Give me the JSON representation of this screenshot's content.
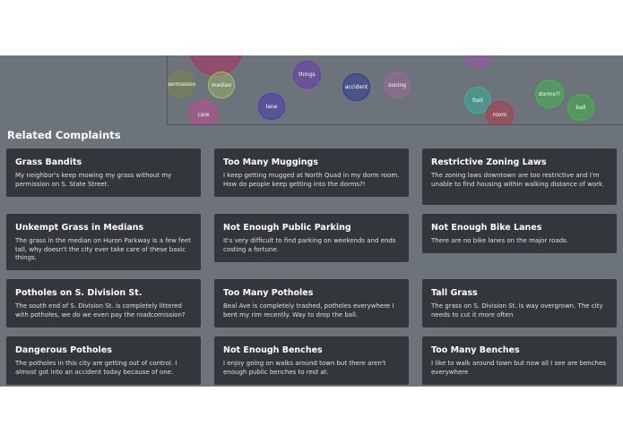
{
  "bubbles": [
    {
      "label": "",
      "color": "#b03060"
    },
    {
      "label": "",
      "color": "#a050b0"
    },
    {
      "label": "permission",
      "color": "#7a8a3a"
    },
    {
      "label": "median",
      "color": "#a8c060"
    },
    {
      "label": "things",
      "color": "#6a3ab0"
    },
    {
      "label": "accident",
      "color": "#303a90"
    },
    {
      "label": "zoning",
      "color": "#a06a9a"
    },
    {
      "label": "lane",
      "color": "#4a3ab0"
    },
    {
      "label": "care",
      "color": "#c04a90"
    },
    {
      "label": "foot",
      "color": "#30b8a0"
    },
    {
      "label": "dorms?!",
      "color": "#3ac04a"
    },
    {
      "label": "room",
      "color": "#b03a4a"
    },
    {
      "label": "ball",
      "color": "#3ac040"
    }
  ],
  "section": {
    "title": "Related Complaints"
  },
  "complaints": [
    {
      "title": "Grass Bandits",
      "body": "My neighbor's keep mowing my grass without my permission on S. State Street."
    },
    {
      "title": "Too Many Muggings",
      "body": "I keep getting mugged at North Quad in my dorm room. How do people keep getting into the dorms?!"
    },
    {
      "title": "Restrictive Zoning Laws",
      "body": "The zoning laws downtown are too restrictive and I'm unable to find housing within walking distance of work."
    },
    {
      "title": "Unkempt Grass in Medians",
      "body": "The grass in the median on Huron Parkway is a few feet tall, why doesn't the city ever take care of these basic things."
    },
    {
      "title": "Not Enough Public Parking",
      "body": "It's very difficult to find parking on weekends and ends costing a fortune."
    },
    {
      "title": "Not Enough Bike Lanes",
      "body": "There are no bike lanes on the major roads."
    },
    {
      "title": "Potholes on S. Division St.",
      "body": "The south end of S. Division St. is completely littered with potholes, we do we even pay the roadcomission?"
    },
    {
      "title": "Too Many Potholes",
      "body": "Beal Ave is completely trashed, potholes everywhere I bent my rim recently. Way to drop the ball."
    },
    {
      "title": "Tall Grass",
      "body": "The grass on S. Division St. is way overgrown. The city needs to cut it more often"
    },
    {
      "title": "Dangerous Potholes",
      "body": "The potholes in this city are getting out of control. I almost got into an accident today because of one."
    },
    {
      "title": "Not Enough Benches",
      "body": "I enjoy going on walks around town but there aren't enough public benches to rest at."
    },
    {
      "title": "Too Many Benches",
      "body": "I like to walk around town but now all I see are benches everywhere"
    }
  ]
}
